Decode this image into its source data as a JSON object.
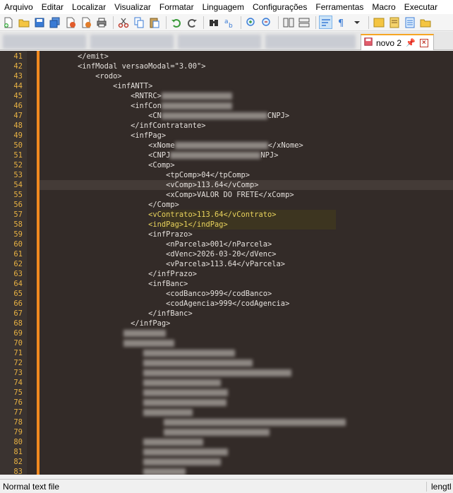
{
  "menu": [
    "Arquivo",
    "Editar",
    "Localizar",
    "Visualizar",
    "Formatar",
    "Linguagem",
    "Configurações",
    "Ferramentas",
    "Macro",
    "Executar"
  ],
  "tab": {
    "label": "novo 2"
  },
  "lines": [
    {
      "n": "41",
      "text": "        </emit>"
    },
    {
      "n": "42",
      "text": "        <infModal versaoModal=\"3.00\">"
    },
    {
      "n": "43",
      "text": "            <rodo>"
    },
    {
      "n": "44",
      "text": "                <infANTT>"
    },
    {
      "n": "45",
      "text": "                    <RNTRC>"
    },
    {
      "n": "46",
      "text": "                    <infCon"
    },
    {
      "n": "47",
      "text": "                        <CN",
      "tail": "CNPJ>"
    },
    {
      "n": "48",
      "text": "                    </infContratante>"
    },
    {
      "n": "49",
      "text": "                    <infPag>"
    },
    {
      "n": "50",
      "text": "                        <xNome",
      "tail": "</xNome>"
    },
    {
      "n": "51",
      "text": "                        <CNPJ",
      "tail": "NPJ>"
    },
    {
      "n": "52",
      "text": "                        <Comp>"
    },
    {
      "n": "53",
      "text": "                            <tpComp>04</tpComp>"
    },
    {
      "n": "54",
      "text": "                            <vComp>113.64</vComp>"
    },
    {
      "n": "55",
      "text": "                            <xComp>VALOR DO FRETE</xComp>"
    },
    {
      "n": "56",
      "text": "                        </Comp>"
    },
    {
      "n": "57",
      "text": "                        <vContrato>113.64</vContrato>"
    },
    {
      "n": "58",
      "text": "                        <indPag>1</indPag>"
    },
    {
      "n": "59",
      "text": "                        <infPrazo>"
    },
    {
      "n": "60",
      "text": "                            <nParcela>001</nParcela>"
    },
    {
      "n": "61",
      "text": "                            <dVenc>2026-03-20</dVenc>"
    },
    {
      "n": "62",
      "text": "                            <vParcela>113.64</vParcela>"
    },
    {
      "n": "63",
      "text": "                        </infPrazo>"
    },
    {
      "n": "64",
      "text": "                        <infBanc>"
    },
    {
      "n": "65",
      "text": "                            <codBanco>999</codBanco>"
    },
    {
      "n": "66",
      "text": "                            <codAgencia>999</codAgencia>"
    },
    {
      "n": "67",
      "text": "                        </infBanc>"
    },
    {
      "n": "68",
      "text": "                    </infPag>"
    },
    {
      "n": "69",
      "text": ""
    },
    {
      "n": "70",
      "text": ""
    },
    {
      "n": "71",
      "text": ""
    },
    {
      "n": "72",
      "text": ""
    },
    {
      "n": "73",
      "text": ""
    },
    {
      "n": "74",
      "text": ""
    },
    {
      "n": "75",
      "text": ""
    },
    {
      "n": "76",
      "text": ""
    },
    {
      "n": "77",
      "text": ""
    },
    {
      "n": "78",
      "text": ""
    },
    {
      "n": "79",
      "text": ""
    },
    {
      "n": "80",
      "text": ""
    },
    {
      "n": "81",
      "text": ""
    },
    {
      "n": "82",
      "text": ""
    },
    {
      "n": "83",
      "text": ""
    }
  ],
  "status": {
    "left": "Normal text file",
    "right": "lengtl"
  }
}
